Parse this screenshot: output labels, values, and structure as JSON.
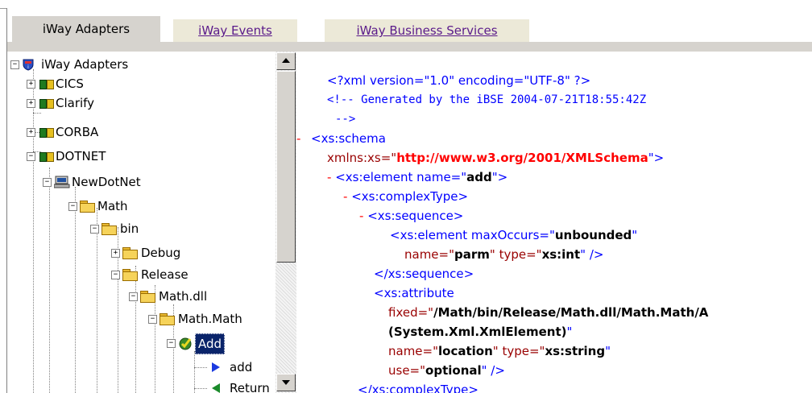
{
  "tabs": {
    "adapters": "iWay Adapters",
    "events": "iWay Events",
    "services": "iWay Business Services"
  },
  "tree": {
    "root": "iWay Adapters",
    "cics": "CICS",
    "clarify": "Clarify",
    "corba": "CORBA",
    "dotnet": "DOTNET",
    "newdotnet": "NewDotNet",
    "math": "Math",
    "bin": "bin",
    "debug": "Debug",
    "release": "Release",
    "mathdll": "Math.dll",
    "mathmath": "Math.Math",
    "add": "Add",
    "add_lower": "add",
    "return": "Return"
  },
  "xml": {
    "l1": "<?xml version=\"1.0\" encoding=\"UTF-8\" ?>",
    "l2": "<!--  Generated by the iBSE 2004-07-21T18:55:42Z",
    "l3": "  -->",
    "l4_dash": "-",
    "l4": "<xs:schema",
    "l5a": "xmlns:xs=\"",
    "l5b": "http://www.w3.org/2001/XMLSchema",
    "l5c": "\">",
    "l6_dash": "-",
    "l6a": "<xs:element name=\"",
    "l6b": "add",
    "l6c": "\">",
    "l7_dash": "-",
    "l7": "<xs:complexType>",
    "l8_dash": "-",
    "l8": "<xs:sequence>",
    "l9a": "<xs:element maxOccurs=\"",
    "l9b": "unbounded",
    "l9c": "\"",
    "l10a": "name=\"",
    "l10b": "parm",
    "l10c": "\" type=\"",
    "l10d": "xs:int",
    "l10e": "\" />",
    "l11": "</xs:sequence>",
    "l12": "<xs:attribute",
    "l13a": "fixed=\"",
    "l13b": "/Math/bin/Release/Math.dll/Math.Math/A",
    "l14a": "(System.Xml.XmlElement)",
    "l14b": "\"",
    "l15a": "name=\"",
    "l15b": "location",
    "l15c": "\" type=\"",
    "l15d": "xs:string",
    "l15e": "\"",
    "l16a": "use=\"",
    "l16b": "optional",
    "l16c": "\" />",
    "l17": "</xs:complexType>"
  }
}
